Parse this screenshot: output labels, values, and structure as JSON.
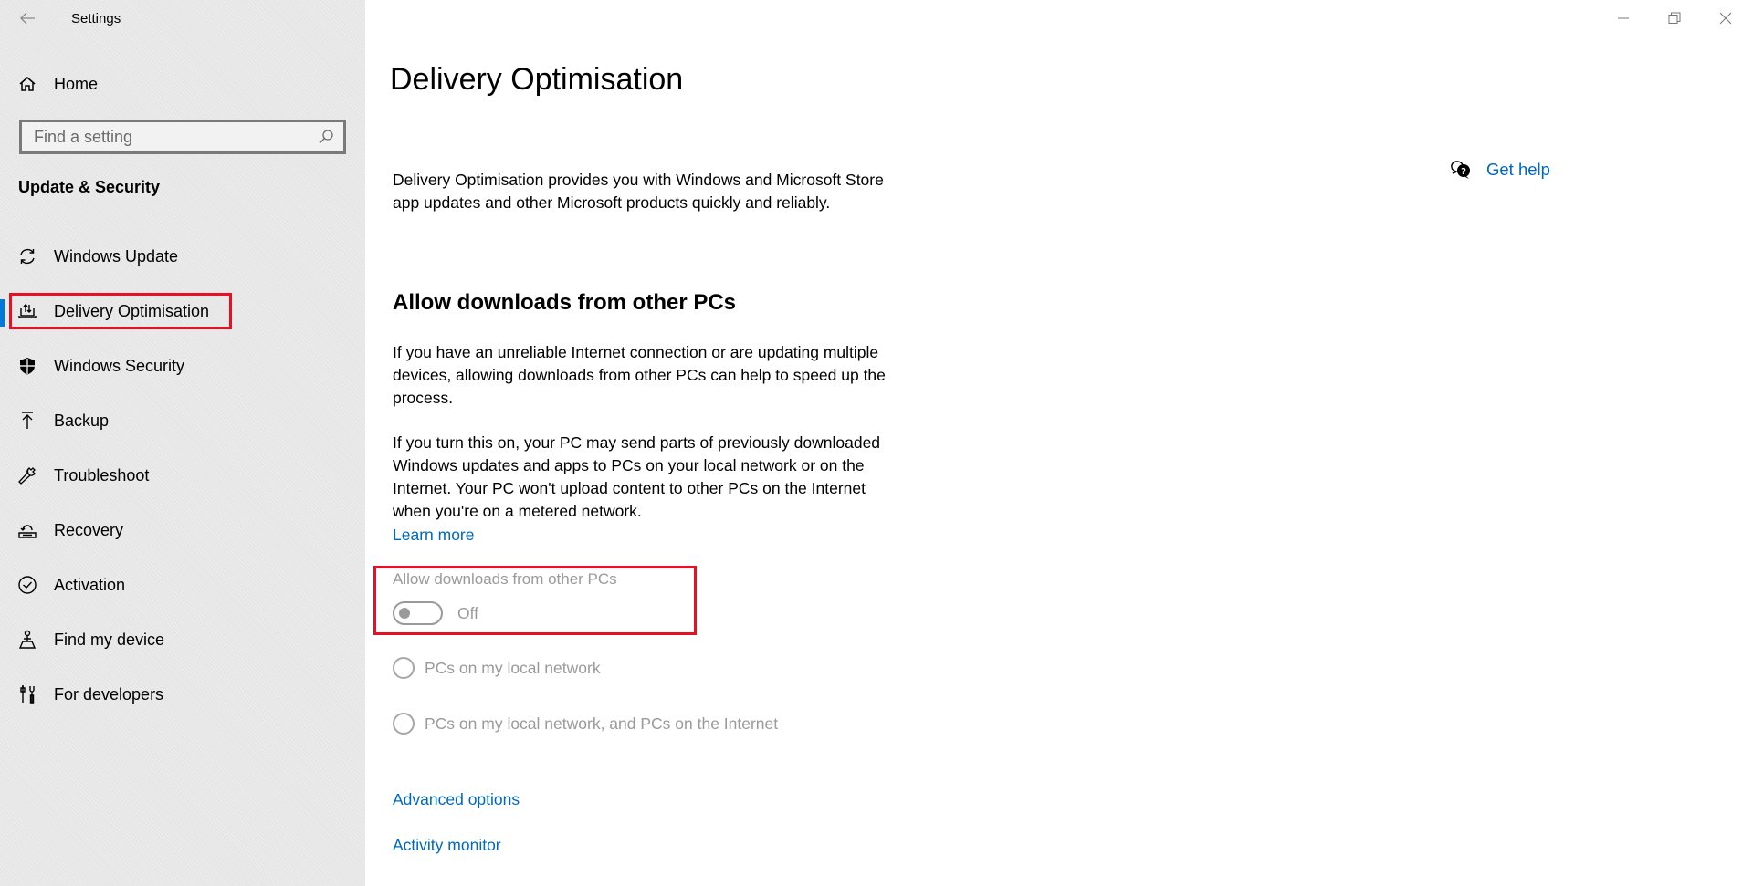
{
  "window": {
    "title": "Settings",
    "controls": {
      "back": "back-arrow-icon",
      "minimize": "minimize-icon",
      "restore": "restore-icon",
      "close": "close-icon"
    }
  },
  "sidebar": {
    "home_label": "Home",
    "search": {
      "placeholder": "Find a setting",
      "value": ""
    },
    "section_title": "Update & Security",
    "items": [
      {
        "label": "Windows Update",
        "icon": "sync-icon",
        "selected": false
      },
      {
        "label": "Delivery Optimisation",
        "icon": "delivery-optimisation-icon",
        "selected": true
      },
      {
        "label": "Windows Security",
        "icon": "shield-icon",
        "selected": false
      },
      {
        "label": "Backup",
        "icon": "upload-arrow-icon",
        "selected": false
      },
      {
        "label": "Troubleshoot",
        "icon": "wrench-icon",
        "selected": false
      },
      {
        "label": "Recovery",
        "icon": "recovery-icon",
        "selected": false
      },
      {
        "label": "Activation",
        "icon": "check-circle-icon",
        "selected": false
      },
      {
        "label": "Find my device",
        "icon": "find-device-icon",
        "selected": false
      },
      {
        "label": "For developers",
        "icon": "developer-tools-icon",
        "selected": false
      }
    ],
    "accent_color": "#0078d7"
  },
  "main": {
    "page_title": "Delivery Optimisation",
    "description": "Delivery Optimisation provides you with Windows and Microsoft Store app updates and other Microsoft products quickly and reliably.",
    "section_heading": "Allow downloads from other PCs",
    "paragraph1": "If you have an unreliable Internet connection or are updating multiple devices, allowing downloads from other PCs can help to speed up the process.",
    "paragraph2": "If you turn this on, your PC may send parts of previously downloaded Windows updates and apps to PCs on your local network or on the Internet. Your PC won't upload content to other PCs on the Internet when you're on a metered network.",
    "learn_more": "Learn more",
    "toggle": {
      "label": "Allow downloads from other PCs",
      "state": "Off",
      "enabled": false
    },
    "radio_options": [
      {
        "label": "PCs on my local network",
        "checked": false
      },
      {
        "label": "PCs on my local network, and PCs on the Internet",
        "checked": false
      }
    ],
    "links": {
      "advanced_options": "Advanced options",
      "activity_monitor": "Activity monitor"
    },
    "get_help": "Get help"
  },
  "annotations": {
    "highlight_color": "#e81123"
  }
}
